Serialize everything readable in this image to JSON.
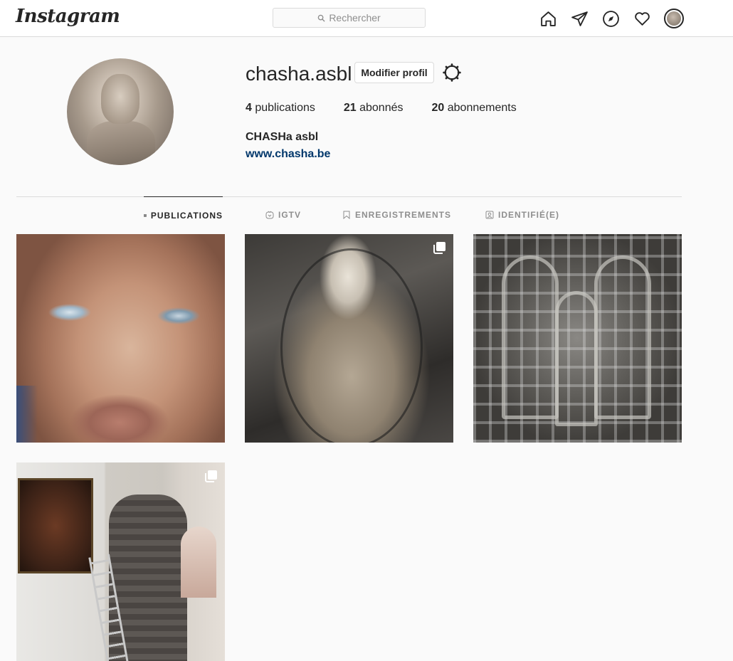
{
  "header": {
    "logo": "Instagram",
    "search_placeholder": "Rechercher",
    "nav_icons": [
      "home-icon",
      "direct-icon",
      "explore-icon",
      "activity-icon",
      "profile-avatar"
    ]
  },
  "profile": {
    "username": "chasha.asbl",
    "edit_button": "Modifier profil",
    "stats": {
      "posts_count": "4",
      "posts_label": "publications",
      "followers_count": "21",
      "followers_label": "abonnés",
      "following_count": "20",
      "following_label": "abonnements"
    },
    "full_name": "CHASHa asbl",
    "website": "www.chasha.be"
  },
  "tabs": [
    {
      "label": "PUBLICATIONS",
      "icon": "grid-icon",
      "active": true
    },
    {
      "label": "IGTV",
      "icon": "igtv-icon",
      "active": false
    },
    {
      "label": "ENREGISTREMENTS",
      "icon": "bookmark-icon",
      "active": false
    },
    {
      "label": "IDENTIFIÉ(E)",
      "icon": "tagged-icon",
      "active": false
    }
  ],
  "posts": [
    {
      "subject": "painted-face",
      "multiple": false
    },
    {
      "subject": "christ-statue",
      "multiple": true
    },
    {
      "subject": "metal-relief",
      "multiple": false
    },
    {
      "subject": "church-interior",
      "multiple": true
    }
  ],
  "colors": {
    "background": "#fafafa",
    "border": "#dbdbdb",
    "text": "#262626",
    "muted": "#8e8e8e",
    "link": "#00376b"
  }
}
